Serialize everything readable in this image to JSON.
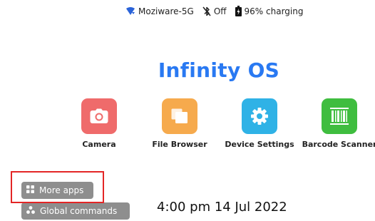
{
  "status_bar": {
    "wifi_icon": "wifi-icon",
    "wifi_name": "Moziware-5G",
    "bluetooth_icon": "bluetooth-off-icon",
    "bluetooth_status": "Off",
    "battery_icon": "battery-charging-icon",
    "battery_text": "96% charging"
  },
  "title": "Infinity OS",
  "apps": [
    {
      "label": "Camera",
      "icon": "camera-icon",
      "color": "#ef6b6b"
    },
    {
      "label": "File Browser",
      "icon": "folder-icon",
      "color": "#f6aa4d"
    },
    {
      "label": "Device Settings",
      "icon": "gear-icon",
      "color": "#2fb2e6"
    },
    {
      "label": "Barcode Scanner",
      "icon": "barcode-icon",
      "color": "#3fbd3f"
    }
  ],
  "buttons": {
    "more_apps": {
      "label": "More apps",
      "icon": "grid-icon"
    },
    "global_commands": {
      "label": "Global commands",
      "icon": "nodes-icon"
    }
  },
  "clock": "4:00 pm 14 Jul 2022",
  "colors": {
    "title": "#2979f2",
    "button_bg": "#8e8e8e",
    "highlight": "#e32626"
  }
}
